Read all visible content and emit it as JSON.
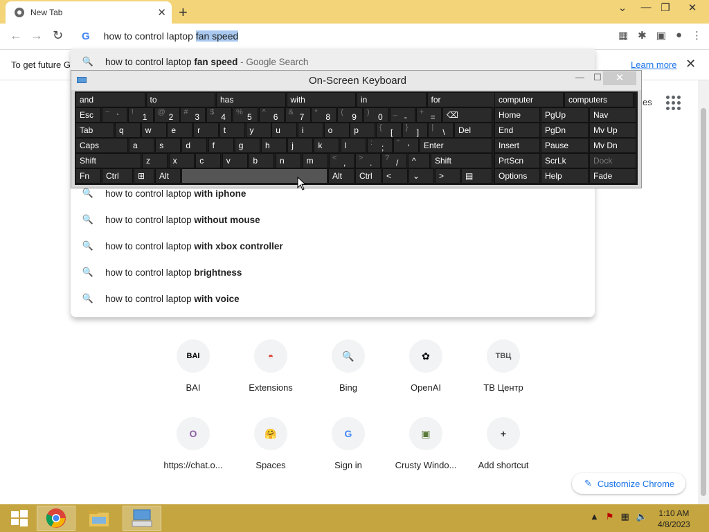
{
  "browser": {
    "tab_title": "New Tab",
    "tab_close": "✕",
    "new_tab": "+",
    "window_controls": {
      "dropdown": "⌄",
      "minimize": "—",
      "restore": "❐",
      "close": "✕"
    }
  },
  "toolbar": {
    "back_icon": "←",
    "forward_icon": "→",
    "reload_icon": "↻"
  },
  "omnibox": {
    "typed_prefix": "how to control laptop ",
    "selected_completion": "fan speed"
  },
  "infobar": {
    "text": "To get future G",
    "learn_more": "Learn more",
    "close": "✕"
  },
  "suggestions": [
    {
      "plain": "how to control laptop ",
      "bold": "fan speed",
      "suffix": " - Google Search"
    },
    {
      "plain": "how to control laptop ",
      "bold": "with iphone",
      "suffix": ""
    },
    {
      "plain": "how to control laptop ",
      "bold": "without mouse",
      "suffix": ""
    },
    {
      "plain": "how to control laptop ",
      "bold": "with xbox controller",
      "suffix": ""
    },
    {
      "plain": "how to control laptop ",
      "bold": "brightness",
      "suffix": ""
    },
    {
      "plain": "how to control laptop ",
      "bold": "with voice",
      "suffix": ""
    }
  ],
  "gmail_peek": "es",
  "osk": {
    "title": "On-Screen Keyboard",
    "predictions": [
      "and",
      "to",
      "has",
      "with",
      "in",
      "for"
    ],
    "pred_right": [
      "computer",
      "computers"
    ],
    "row1": [
      [
        "~",
        "`"
      ],
      [
        "!",
        "1"
      ],
      [
        "@",
        "2"
      ],
      [
        "#",
        "3"
      ],
      [
        "$",
        "4"
      ],
      [
        "%",
        "5"
      ],
      [
        "^",
        "6"
      ],
      [
        "&",
        "7"
      ],
      [
        "*",
        "8"
      ],
      [
        "(",
        "9"
      ],
      [
        ")",
        "0"
      ],
      [
        "_",
        "-"
      ],
      [
        "+",
        "="
      ]
    ],
    "row2": [
      "q",
      "w",
      "e",
      "r",
      "t",
      "y",
      "u",
      "i",
      "o",
      "p"
    ],
    "row2sym": [
      [
        "{",
        "["
      ],
      [
        "}",
        "]"
      ],
      [
        "|",
        "\\"
      ]
    ],
    "row3": [
      "a",
      "s",
      "d",
      "f",
      "g",
      "h",
      "j",
      "k",
      "l"
    ],
    "row3sym": [
      [
        ":",
        ";"
      ],
      [
        "\"",
        "'"
      ]
    ],
    "row4": [
      "z",
      "x",
      "c",
      "v",
      "b",
      "n",
      "m"
    ],
    "row4sym": [
      [
        "<",
        ","
      ],
      [
        ">",
        "."
      ],
      [
        "?",
        "/"
      ]
    ],
    "keys": {
      "esc": "Esc",
      "tab": "Tab",
      "caps": "Caps",
      "shift": "Shift",
      "fn": "Fn",
      "ctrl": "Ctrl",
      "alt": "Alt",
      "del": "Del",
      "enter": "Enter",
      "shift_r": "Shift",
      "alt_r": "Alt",
      "ctrl_r": "Ctrl",
      "left": "<",
      "down": "⌄",
      "right": ">",
      "up": "^",
      "home": "Home",
      "pgup": "PgUp",
      "nav": "Nav",
      "end": "End",
      "pgdn": "PgDn",
      "mvup": "Mv Up",
      "insert": "Insert",
      "pause": "Pause",
      "mvdn": "Mv Dn",
      "prtscn": "PrtScn",
      "scrlk": "ScrLk",
      "dock": "Dock",
      "options": "Options",
      "help": "Help",
      "fade": "Fade"
    }
  },
  "tiles_row1": [
    {
      "label": "BAI",
      "glyph": "BAI",
      "color": "#000000"
    },
    {
      "label": "Extensions",
      "glyph": "◓",
      "color": "#db4437"
    },
    {
      "label": "Bing",
      "glyph": "🔍",
      "color": "#1a73e8"
    },
    {
      "label": "OpenAI",
      "glyph": "✿",
      "color": "#000000"
    },
    {
      "label": "ТВ Центр",
      "glyph": "ТВЦ",
      "color": "#555555"
    }
  ],
  "tiles_row2": [
    {
      "label": "https://chat.o...",
      "glyph": "O",
      "color": "#8e5ea2"
    },
    {
      "label": "Spaces",
      "glyph": "🤗",
      "color": "#f5c518"
    },
    {
      "label": "Sign in",
      "glyph": "G",
      "color": "#4285f4"
    },
    {
      "label": "Crusty Windo...",
      "glyph": "▣",
      "color": "#5a7a3a"
    },
    {
      "label": "Add shortcut",
      "glyph": "+",
      "color": "#222222"
    }
  ],
  "customize": "Customize Chrome",
  "taskbar": {
    "time": "1:10 AM",
    "date": "4/8/2023",
    "tray": [
      "▲",
      "⚑",
      "▦",
      "🔈"
    ]
  }
}
